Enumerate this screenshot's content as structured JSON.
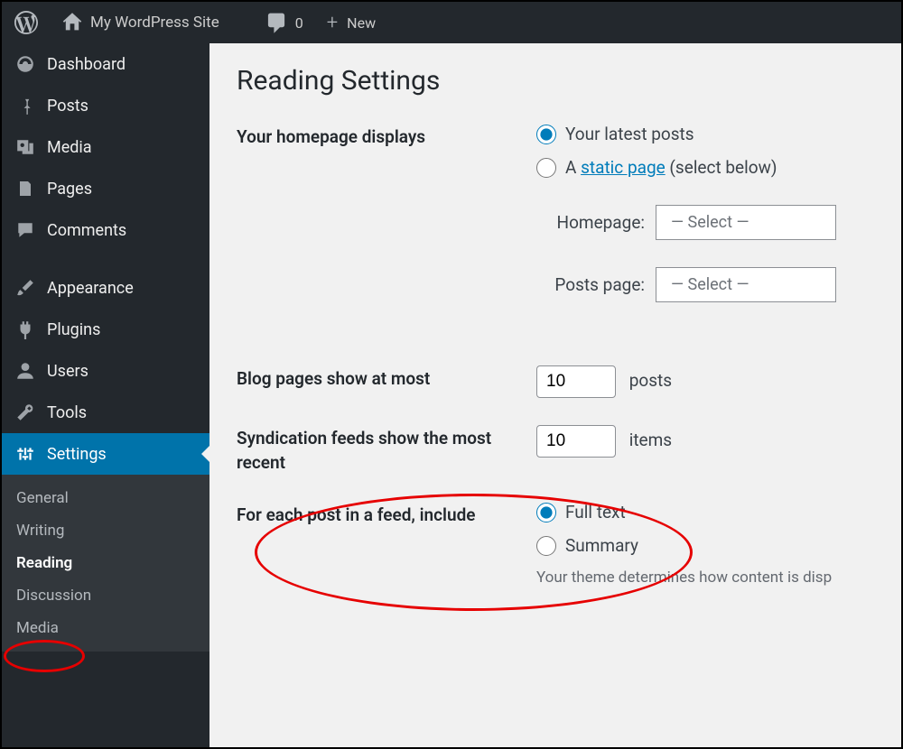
{
  "adminbar": {
    "site_title": "My WordPress Site",
    "comments_count": "0",
    "new_label": "New"
  },
  "sidebar": {
    "items": [
      {
        "label": "Dashboard"
      },
      {
        "label": "Posts"
      },
      {
        "label": "Media"
      },
      {
        "label": "Pages"
      },
      {
        "label": "Comments"
      },
      {
        "label": "Appearance"
      },
      {
        "label": "Plugins"
      },
      {
        "label": "Users"
      },
      {
        "label": "Tools"
      },
      {
        "label": "Settings"
      }
    ],
    "submenu": [
      {
        "label": "General"
      },
      {
        "label": "Writing"
      },
      {
        "label": "Reading"
      },
      {
        "label": "Discussion"
      },
      {
        "label": "Media"
      }
    ]
  },
  "page": {
    "title": "Reading Settings",
    "homepage_label": "Your homepage displays",
    "radio_latest": "Your latest posts",
    "radio_static_prefix": "A ",
    "radio_static_link": "static page",
    "radio_static_suffix": " (select below)",
    "homepage_select_label": "Homepage:",
    "postspage_select_label": "Posts page:",
    "select_placeholder": "— Select —",
    "blog_pages_label": "Blog pages show at most",
    "blog_pages_value": "10",
    "blog_pages_suffix": "posts",
    "syndication_label": "Syndication feeds show the most recent",
    "syndication_value": "10",
    "syndication_suffix": "items",
    "feed_include_label": "For each post in a feed, include",
    "feed_full_text": "Full text",
    "feed_summary": "Summary",
    "feed_hint": "Your theme determines how content is disp"
  }
}
